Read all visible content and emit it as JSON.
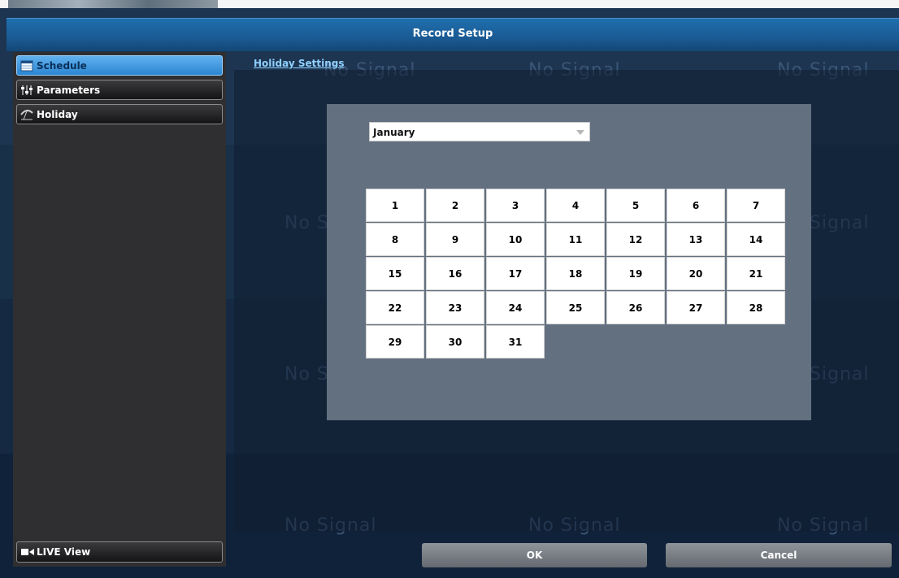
{
  "background": {
    "no_signal_text": "No Signal"
  },
  "title": "Record Setup",
  "sidebar": {
    "items": [
      {
        "label": "Schedule",
        "icon": "calendar-icon",
        "active": true
      },
      {
        "label": "Parameters",
        "icon": "sliders-icon",
        "active": false
      },
      {
        "label": "Holiday",
        "icon": "umbrella-icon",
        "active": false
      }
    ],
    "live_view": {
      "label": "LIVE View",
      "icon": "camera-icon"
    }
  },
  "main": {
    "section_link": "Holiday Settings",
    "month_select": {
      "value": "January"
    },
    "days": [
      "1",
      "2",
      "3",
      "4",
      "5",
      "6",
      "7",
      "8",
      "9",
      "10",
      "11",
      "12",
      "13",
      "14",
      "15",
      "16",
      "17",
      "18",
      "19",
      "20",
      "21",
      "22",
      "23",
      "24",
      "25",
      "26",
      "27",
      "28",
      "29",
      "30",
      "31"
    ]
  },
  "footer": {
    "ok_label": "OK",
    "cancel_label": "Cancel"
  },
  "colors": {
    "title_bar": "#1a5a93",
    "active_tab": "#2a86d2",
    "link": "#8fd0ff"
  }
}
